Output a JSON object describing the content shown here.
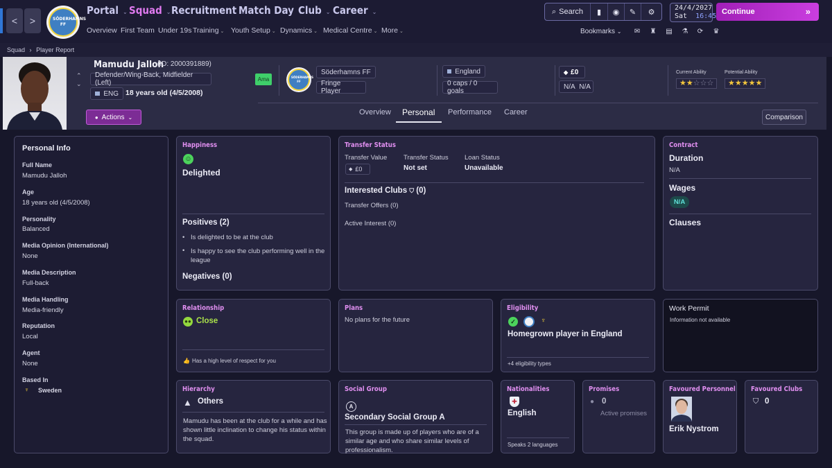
{
  "nav": {
    "back": "<",
    "forward": ">",
    "club_crest_text": "SÖDERHAMNS FF",
    "main": [
      "Portal",
      "Squad",
      "Recruitment",
      "Match Day",
      "Club",
      "Career"
    ],
    "sub": [
      "Overview",
      "First Team",
      "Under 19s",
      "Training",
      "Youth Setup",
      "Dynamics",
      "Medical Centre",
      "More"
    ],
    "search_label": "Search",
    "date": "24/4/2027",
    "day": "Sat",
    "time": "16:45",
    "continue_label": "Continue",
    "bookmarks_label": "Bookmarks"
  },
  "breadcrumb": {
    "root": "Squad",
    "current": "Player Report"
  },
  "player": {
    "name": "Mamudu Jalloh",
    "id": "(ID: 2000391889)",
    "position": "Defender/Wing-Back, Midfielder (Left)",
    "nation_code": "ENG",
    "age": "18 years old (4/5/2008)",
    "status_badge": "Ama",
    "club": "Söderhamns FF",
    "squad_status": "Fringe Player",
    "country": "England",
    "caps": "0 caps / 0 goals",
    "value": "£0",
    "wage": "N/A",
    "wage2": "N/A",
    "current_ability_label": "Current Ability",
    "potential_ability_label": "Potential Ability",
    "current_ability_stars": 2,
    "potential_ability_stars": 5,
    "actions_label": "Actions"
  },
  "tabs": [
    "Overview",
    "Personal",
    "Performance",
    "Career"
  ],
  "comparison_label": "Comparison",
  "personal_info": {
    "title": "Personal Info",
    "fields": [
      {
        "label": "Full Name",
        "value": "Mamudu Jalloh"
      },
      {
        "label": "Age",
        "value": "18 years old (4/5/2008)"
      },
      {
        "label": "Personality",
        "value": "Balanced"
      },
      {
        "label": "Media Opinion (International)",
        "value": "None"
      },
      {
        "label": "Media Description",
        "value": "Full-back"
      },
      {
        "label": "Media Handling",
        "value": "Media-friendly"
      },
      {
        "label": "Reputation",
        "value": "Local"
      },
      {
        "label": "Agent",
        "value": "None"
      }
    ],
    "based_in_label": "Based In",
    "based_in_value": "Sweden"
  },
  "happiness": {
    "title": "Happiness",
    "state": "Delighted",
    "positives_title": "Positives (2)",
    "positives": [
      "Is delighted to be at the club",
      "Is happy to see the club performing well in the league"
    ],
    "negatives_title": "Negatives (0)"
  },
  "transfer": {
    "title": "Transfer Status",
    "value_label": "Transfer Value",
    "value": "£0",
    "status_label": "Transfer Status",
    "status": "Not set",
    "loan_label": "Loan Status",
    "loan": "Unavailable",
    "interested_title": "Interested Clubs",
    "interested_count": "(0)",
    "offers": "Transfer Offers  (0)",
    "active_interest": "Active Interest  (0)"
  },
  "contract": {
    "title": "Contract",
    "duration_label": "Duration",
    "duration": "N/A",
    "wages_label": "Wages",
    "wages": "N/A",
    "clauses_label": "Clauses"
  },
  "relationship": {
    "title": "Relationship",
    "state": "Close",
    "note": "Has a high level of respect for you"
  },
  "plans": {
    "title": "Plans",
    "text": "No plans for the future"
  },
  "eligibility": {
    "title": "Eligibility",
    "text": "Homegrown player in England",
    "note": "+4 eligibility types"
  },
  "work_permit": {
    "title": "Work Permit",
    "text": "Information not available"
  },
  "hierarchy": {
    "title": "Hierarchy",
    "level": "Others",
    "text": "Mamudu has been at the club for a while and has shown little inclination to change his status within the squad."
  },
  "social_group": {
    "title": "Social Group",
    "group": "Secondary Social Group A",
    "badge": "A",
    "text": "This group is made up of players who are of a similar age and who share similar levels of professionalism."
  },
  "nationalities": {
    "title": "Nationalities",
    "nation": "English",
    "note": "Speaks 2 languages"
  },
  "promises": {
    "title": "Promises",
    "count": "0",
    "label": "Active promises"
  },
  "favoured_personnel": {
    "title": "Favoured Personnel",
    "name": "Erik Nystrom"
  },
  "favoured_clubs": {
    "title": "Favoured Clubs",
    "count": "0"
  },
  "colors": {
    "accent": "#e08ff0",
    "continue": "#b52ccb",
    "positive": "#7ed321",
    "background": "#17172a"
  }
}
